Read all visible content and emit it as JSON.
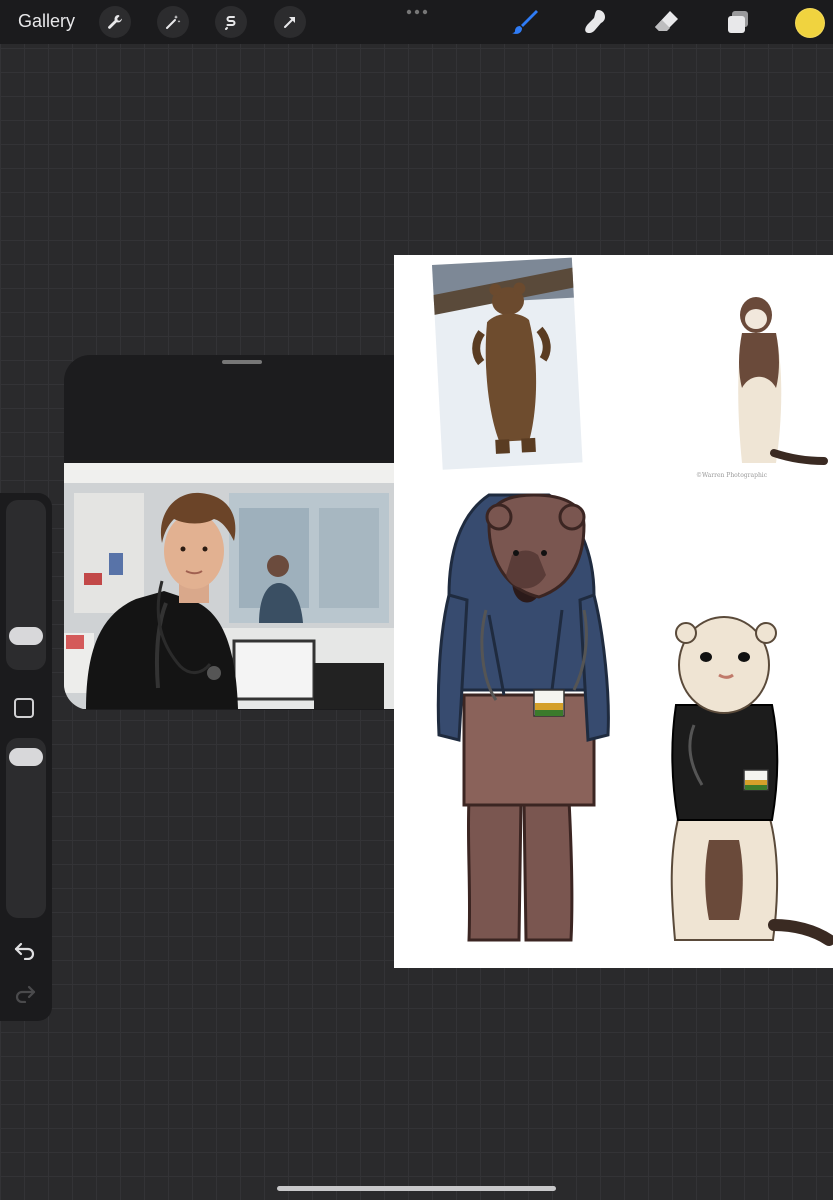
{
  "topbar": {
    "gallery_label": "Gallery",
    "left_tools": [
      "wrench-icon",
      "magic-wand-icon",
      "selection-s-icon",
      "transform-arrow-icon"
    ],
    "more_menu": "ellipsis-icon",
    "right_tools": [
      "brush-icon",
      "smudge-icon",
      "eraser-icon",
      "layers-icon"
    ],
    "active_tool": "brush",
    "accent": "#2f7cf6",
    "current_color": "#f0d33f"
  },
  "sidebar": {
    "brush_size_level": 0.2,
    "opacity_level": 0.95,
    "modify_button": "square-icon",
    "undo": "undo-icon",
    "redo": "redo-icon"
  },
  "reference_panel": {
    "grabber": "drag-handle"
  },
  "canvas": {
    "watermark": "©Warren Photographic"
  }
}
